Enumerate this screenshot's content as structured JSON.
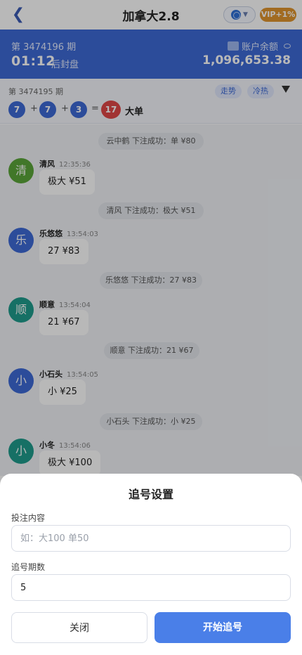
{
  "header": {
    "title": "加拿大2.8",
    "back_icon": "chevron-left-icon",
    "vip_badge": "VIP+1%"
  },
  "period_panel": {
    "current_period": "第 3474196 期",
    "countdown": "01:12",
    "countdown_note": "后封盘",
    "balance_label": "账户余额",
    "balance": "1,096,653.38"
  },
  "last_result": {
    "period": "第 3474195 期",
    "balls": [
      "7",
      "7",
      "3"
    ],
    "plus": "+",
    "equals": "=",
    "sum": "17",
    "outcome": "大单",
    "chips": [
      "走势",
      "冷热"
    ]
  },
  "chat": {
    "system_messages": [
      "云中鹤 下注成功：单 ¥80",
      "清风 下注成功：极大 ¥51",
      "乐悠悠 下注成功：27 ¥83",
      "顺意 下注成功：21 ¥67",
      "小石头 下注成功：小 ¥25"
    ],
    "messages": [
      {
        "avatar": "清",
        "name": "清风",
        "time": "12:35:36",
        "text": "极大 ¥51"
      },
      {
        "avatar": "乐",
        "name": "乐悠悠",
        "time": "13:54:03",
        "text": "27 ¥83"
      },
      {
        "avatar": "顺",
        "name": "顺意",
        "time": "13:54:04",
        "text": "21 ¥67"
      },
      {
        "avatar": "小",
        "name": "小石头",
        "time": "13:54:05",
        "text": "小 ¥25"
      },
      {
        "avatar": "小",
        "name": "小冬",
        "time": "13:54:06",
        "text": "极大 ¥100"
      }
    ]
  },
  "sheet": {
    "title": "追号设置",
    "content_label": "投注内容",
    "content_placeholder": "如：大100 单50",
    "periods_label": "追号期数",
    "periods_value": "5",
    "close_button": "关闭",
    "start_button": "开始追号"
  },
  "colors": {
    "brand_blue": "#3d6ad6",
    "vip_orange": "#e0952f",
    "ball_red": "#e04747",
    "button_blue": "#4a7fe8"
  }
}
